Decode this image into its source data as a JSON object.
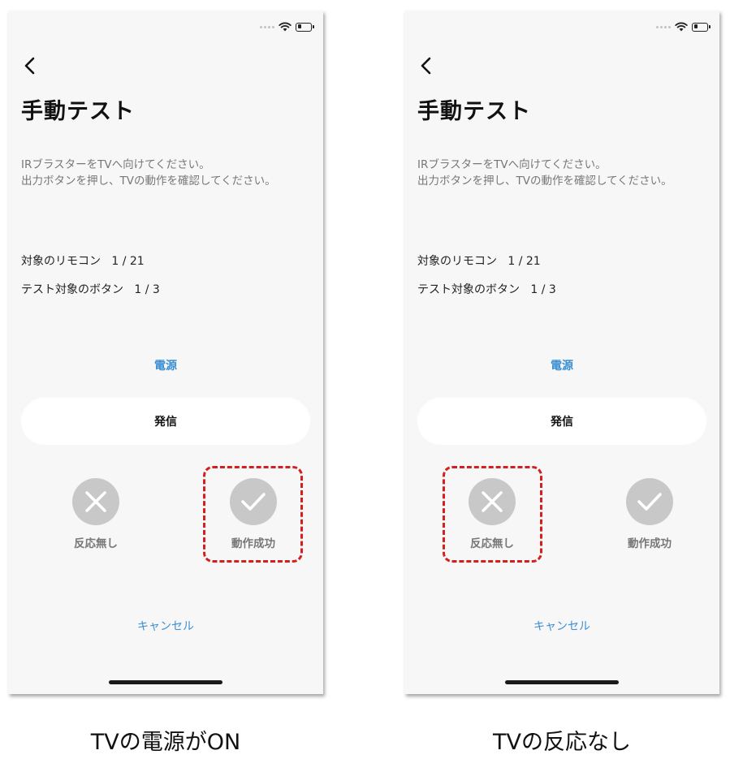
{
  "screens": [
    {
      "title": "手動テスト",
      "instruction_line1": "IRブラスターをTVへ向けてください。",
      "instruction_line2": "出力ボタンを押し、TVの動作を確認してください。",
      "remote_label": "対象のリモコン",
      "remote_count": "1 / 21",
      "button_label": "テスト対象のボタン",
      "button_count": "1 / 3",
      "button_name": "電源",
      "send_label": "発信",
      "fail_label": "反応無し",
      "success_label": "動作成功",
      "cancel_label": "キャンセル",
      "highlighted": "success",
      "caption": "TVの電源がON"
    },
    {
      "title": "手動テスト",
      "instruction_line1": "IRブラスターをTVへ向けてください。",
      "instruction_line2": "出力ボタンを押し、TVの動作を確認してください。",
      "remote_label": "対象のリモコン",
      "remote_count": "1 / 21",
      "button_label": "テスト対象のボタン",
      "button_count": "1 / 3",
      "button_name": "電源",
      "send_label": "発信",
      "fail_label": "反応無し",
      "success_label": "動作成功",
      "cancel_label": "キャンセル",
      "highlighted": "fail",
      "caption": "TVの反応なし"
    }
  ],
  "colors": {
    "accent": "#3b8fd4",
    "highlight": "#d41f1f",
    "icon_circle": "#c8c8c8"
  },
  "icons": {
    "back": "chevron-left-icon",
    "fail": "close-icon",
    "success": "check-icon",
    "wifi": "wifi-icon",
    "battery": "battery-icon"
  },
  "battery_level": 0.35
}
